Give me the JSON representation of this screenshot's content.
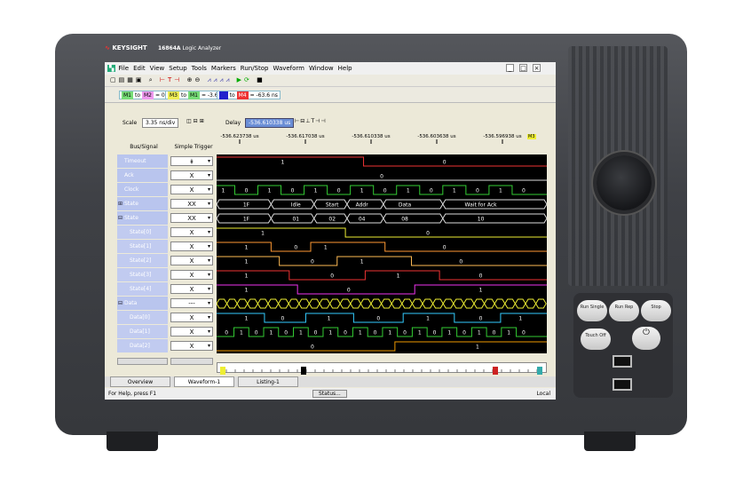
{
  "instrument": {
    "brand": "KEYSIGHT",
    "model": "16864A",
    "model_desc": "Logic Analyzer"
  },
  "hard_buttons": {
    "run_single": "Run Single",
    "run_rep": "Run Rep",
    "stop": "Stop",
    "touch_off": "Touch Off"
  },
  "menu": [
    "File",
    "Edit",
    "View",
    "Setup",
    "Tools",
    "Markers",
    "Run/Stop",
    "Waveform",
    "Window",
    "Help"
  ],
  "window_controls": [
    "_",
    "□",
    "×"
  ],
  "markers": [
    {
      "a": "M1",
      "b": "M2",
      "value": "= 0 s"
    },
    {
      "a": "M3",
      "b": "M1",
      "value": "= -3.6 ns"
    },
    {
      "a": "",
      "b": "M4",
      "value": "= -63.6 ns"
    }
  ],
  "controls": {
    "scale_label": "Scale",
    "scale_value": "3.35 ns/div",
    "delay_label": "Delay",
    "delay_value": "-536.610338 us"
  },
  "time_ticks": [
    "-536.623738 us",
    "-536.617038 us",
    "-536.610338 us",
    "-536.603638 us",
    "-536.596938 us"
  ],
  "columns": {
    "bus_signal": "Bus/Signal",
    "simple_trigger": "Simple Trigger"
  },
  "signals": [
    {
      "name": "Timeout",
      "trig": "↡",
      "labels": [
        {
          "t": "1",
          "x": 0.2
        },
        {
          "t": "0",
          "x": 0.69
        }
      ]
    },
    {
      "name": "Ack",
      "trig": "X",
      "labels": [
        {
          "t": "0",
          "x": 0.5
        }
      ]
    },
    {
      "name": "Clock",
      "trig": "X",
      "labels": [
        {
          "t": "1",
          "x": 0.02
        },
        {
          "t": "0",
          "x": 0.09
        },
        {
          "t": "1",
          "x": 0.16
        },
        {
          "t": "0",
          "x": 0.23
        },
        {
          "t": "1",
          "x": 0.3
        },
        {
          "t": "0",
          "x": 0.37
        },
        {
          "t": "1",
          "x": 0.44
        },
        {
          "t": "0",
          "x": 0.51
        },
        {
          "t": "1",
          "x": 0.58
        },
        {
          "t": "0",
          "x": 0.65
        },
        {
          "t": "1",
          "x": 0.72
        },
        {
          "t": "0",
          "x": 0.79
        },
        {
          "t": "1",
          "x": 0.86
        },
        {
          "t": "0",
          "x": 0.93
        }
      ]
    },
    {
      "name": "State",
      "trig": "XX",
      "labels": [
        {
          "t": "1F",
          "x": 0.09
        },
        {
          "t": "Idle",
          "x": 0.24
        },
        {
          "t": "Start",
          "x": 0.35
        },
        {
          "t": "Addr",
          "x": 0.44
        },
        {
          "t": "Data",
          "x": 0.57
        },
        {
          "t": "Wait for Ack",
          "x": 0.8
        }
      ]
    },
    {
      "name": "State",
      "trig": "XX",
      "labels": [
        {
          "t": "1F",
          "x": 0.09
        },
        {
          "t": "01",
          "x": 0.24
        },
        {
          "t": "02",
          "x": 0.35
        },
        {
          "t": "04",
          "x": 0.44
        },
        {
          "t": "08",
          "x": 0.57
        },
        {
          "t": "10",
          "x": 0.8
        }
      ]
    },
    {
      "name": "State[0]",
      "trig": "X",
      "labels": [
        {
          "t": "1",
          "x": 0.14
        },
        {
          "t": "0",
          "x": 0.64
        }
      ]
    },
    {
      "name": "State[1]",
      "trig": "X",
      "labels": [
        {
          "t": "1",
          "x": 0.09
        },
        {
          "t": "0",
          "x": 0.24
        },
        {
          "t": "1",
          "x": 0.33
        },
        {
          "t": "0",
          "x": 0.69
        }
      ]
    },
    {
      "name": "State[2]",
      "trig": "X",
      "labels": [
        {
          "t": "1",
          "x": 0.09
        },
        {
          "t": "0",
          "x": 0.29
        },
        {
          "t": "1",
          "x": 0.44
        },
        {
          "t": "0",
          "x": 0.74
        }
      ]
    },
    {
      "name": "State[3]",
      "trig": "X",
      "labels": [
        {
          "t": "1",
          "x": 0.09
        },
        {
          "t": "0",
          "x": 0.35
        },
        {
          "t": "1",
          "x": 0.55
        },
        {
          "t": "0",
          "x": 0.8
        }
      ]
    },
    {
      "name": "State[4]",
      "trig": "X",
      "labels": [
        {
          "t": "1",
          "x": 0.09
        },
        {
          "t": "0",
          "x": 0.4
        },
        {
          "t": "1",
          "x": 0.8
        }
      ]
    },
    {
      "name": "Data",
      "trig": "---",
      "labels": []
    },
    {
      "name": "Data[0]",
      "trig": "X",
      "labels": [
        {
          "t": "1",
          "x": 0.09
        },
        {
          "t": "0",
          "x": 0.2
        },
        {
          "t": "1",
          "x": 0.34
        },
        {
          "t": "0",
          "x": 0.49
        },
        {
          "t": "1",
          "x": 0.64
        },
        {
          "t": "0",
          "x": 0.8
        },
        {
          "t": "1",
          "x": 0.92
        }
      ]
    },
    {
      "name": "Data[1]",
      "trig": "X",
      "labels": [
        {
          "t": "0",
          "x": 0.03
        },
        {
          "t": "1",
          "x": 0.075
        },
        {
          "t": "0",
          "x": 0.12
        },
        {
          "t": "1",
          "x": 0.165
        },
        {
          "t": "0",
          "x": 0.21
        },
        {
          "t": "1",
          "x": 0.255
        },
        {
          "t": "0",
          "x": 0.3
        },
        {
          "t": "1",
          "x": 0.345
        },
        {
          "t": "0",
          "x": 0.39
        },
        {
          "t": "1",
          "x": 0.435
        },
        {
          "t": "0",
          "x": 0.48
        },
        {
          "t": "1",
          "x": 0.525
        },
        {
          "t": "0",
          "x": 0.57
        },
        {
          "t": "1",
          "x": 0.615
        },
        {
          "t": "0",
          "x": 0.66
        },
        {
          "t": "1",
          "x": 0.705
        },
        {
          "t": "0",
          "x": 0.75
        },
        {
          "t": "1",
          "x": 0.795
        },
        {
          "t": "0",
          "x": 0.84
        },
        {
          "t": "1",
          "x": 0.885
        },
        {
          "t": "0",
          "x": 0.93
        }
      ]
    },
    {
      "name": "Data[2]",
      "trig": "X",
      "labels": [
        {
          "t": "0",
          "x": 0.29
        },
        {
          "t": "1",
          "x": 0.79
        }
      ]
    }
  ],
  "tabs": [
    "Overview",
    "Waveform-1",
    "Listing-1"
  ],
  "status": {
    "help": "For Help, press F1",
    "status_button": "Status...",
    "mode": "Local"
  }
}
